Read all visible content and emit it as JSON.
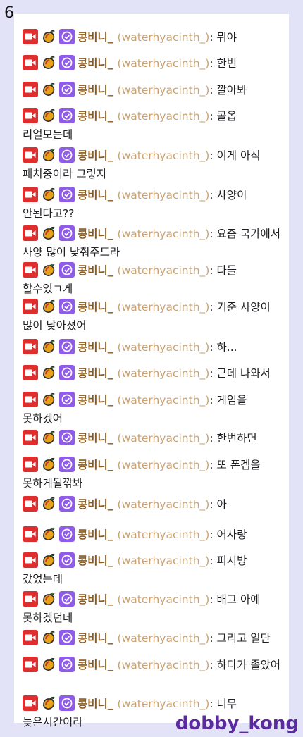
{
  "page_number": "6",
  "watermark": "dobby_kong",
  "user": {
    "display_name": "콩비니_",
    "login": "(waterhyacinth_)"
  },
  "messages": [
    "뭐야",
    "한번",
    "깔아봐",
    "콜옵 리얼모든데",
    "이게 아직 패치중이라 그렇지",
    "사양이 안된다고??",
    "요즘 국가에서 사양 많이 낮춰주드라",
    "다들 할수있ㄱ게",
    "기준 사양이 많이 낮아졌어",
    "하...",
    "근데 나와서",
    "게임을 못하겠어",
    "한번하면",
    "또 폰겜을 못하게될깎봐",
    "아",
    "어사랑",
    "피시방 갔었는데",
    "배그 아예 못하겠던데",
    "그리고 일단",
    "하다가 졸았어",
    "너무 늦은시간이라"
  ],
  "colors": {
    "page_bg": "#e3e3f8",
    "panel_bg": "#ffffff",
    "display_name": "#8a5a1c",
    "login": "#c9a273",
    "text": "#1f1f23",
    "broadcaster_badge": "#e02d2d",
    "verified_badge": "#8f5be8",
    "watermark": "#5a2a9e"
  },
  "badge_icons": [
    "broadcaster-camera-icon",
    "mango-fruit-icon",
    "verified-check-icon"
  ]
}
